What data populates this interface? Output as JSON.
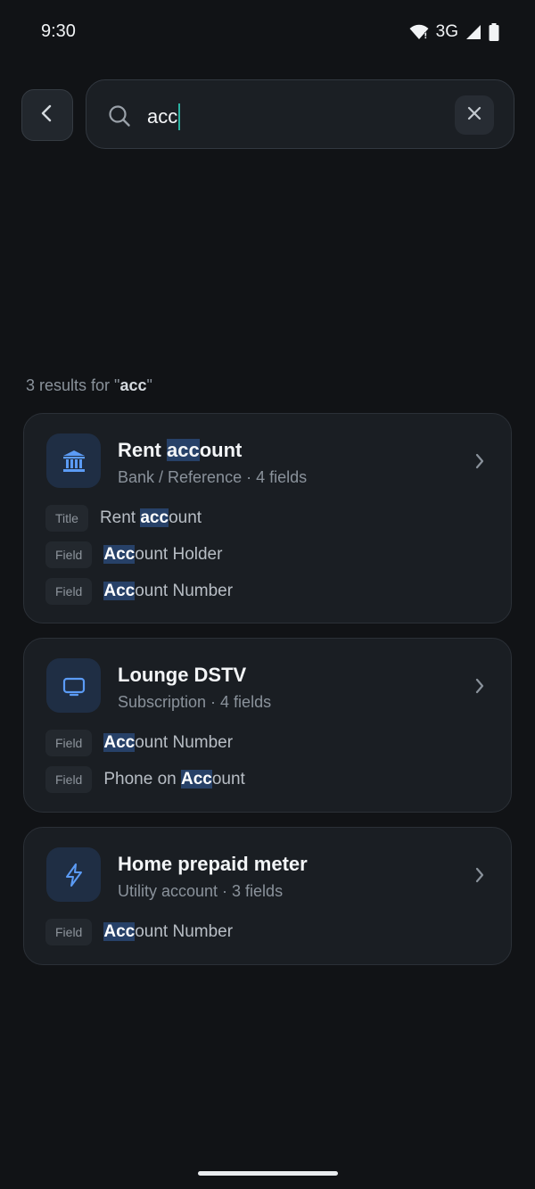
{
  "status": {
    "time": "9:30",
    "network": "3G"
  },
  "search": {
    "query": "acc"
  },
  "results": {
    "prefix": "3 results for \"",
    "query": "acc",
    "suffix": "\""
  },
  "icons": {
    "back": "chevron-left-icon",
    "search": "search-icon",
    "clear": "close-icon",
    "bank": "bank-icon",
    "tv": "tv-icon",
    "bolt": "bolt-icon",
    "open": "chevron-right-icon"
  },
  "colors": {
    "accent": "#5b9bf5",
    "highlight": "#274168",
    "caret": "#2bb3a3"
  },
  "cards": [
    {
      "title": {
        "pre": "Rent ",
        "hl": "acc",
        "post": "ount"
      },
      "subtitle": "Bank / Reference · 4 fields",
      "matches": [
        {
          "tag": "Title",
          "pre": "Rent ",
          "hl": "acc",
          "post": "ount"
        },
        {
          "tag": "Field",
          "pre": "",
          "hl": "Acc",
          "post": "ount Holder"
        },
        {
          "tag": "Field",
          "pre": "",
          "hl": "Acc",
          "post": "ount Number"
        }
      ]
    },
    {
      "title": "Lounge DSTV",
      "subtitle": "Subscription · 4 fields",
      "matches": [
        {
          "tag": "Field",
          "pre": "",
          "hl": "Acc",
          "post": "ount Number"
        },
        {
          "tag": "Field",
          "pre": "Phone on ",
          "hl": "Acc",
          "post": "ount"
        }
      ]
    },
    {
      "title": "Home prepaid meter",
      "subtitle": "Utility account · 3 fields",
      "matches": [
        {
          "tag": "Field",
          "pre": "",
          "hl": "Acc",
          "post": "ount Number"
        }
      ]
    }
  ]
}
